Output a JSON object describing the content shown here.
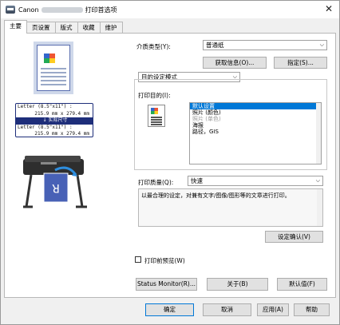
{
  "window": {
    "title_prefix": "Canon",
    "title_suffix": "打印首选项",
    "close_glyph": "✕"
  },
  "tabs": [
    {
      "label": "主要"
    },
    {
      "label": "页设置"
    },
    {
      "label": "版式"
    },
    {
      "label": "收藏"
    },
    {
      "label": "维护"
    }
  ],
  "preview": {
    "paper_line1": "Letter (8.5\"x11\") :",
    "paper_line2": "215.9 mm x 279.4 mm",
    "actual_size": "↓ 实际尺寸",
    "paper_line3": "Letter (8.5\"x11\") :",
    "paper_line4": "215.9 mm x 279.4 mm",
    "printer_roll_glyph": "R"
  },
  "media": {
    "label": "介质类型(Y):",
    "value": "普通纸",
    "get_info_button": "获取信息(O)...",
    "specify_button": "指定(S)..."
  },
  "mode": {
    "value": "目的设定模式"
  },
  "purpose": {
    "label": "打印目的(I):",
    "items": [
      "默认设置",
      "照片 (颜色)",
      "照片 (单色)",
      "海报",
      "路径，GIS"
    ]
  },
  "quality": {
    "label": "打印质量(Q):",
    "value": "快速",
    "description": "以最合理的设定，对兼有文字/图像/图形等的文章进行打印。",
    "confirm_button": "设定确认(V)"
  },
  "preview_before_print": {
    "label": "打印前预览(W)"
  },
  "footer_row1": {
    "status_monitor": "Status Monitor(R)...",
    "about": "关于(B)",
    "defaults": "默认值(F)"
  },
  "footer_row2": {
    "ok": "确定",
    "cancel": "取消",
    "apply": "应用(A)",
    "help": "帮助"
  }
}
